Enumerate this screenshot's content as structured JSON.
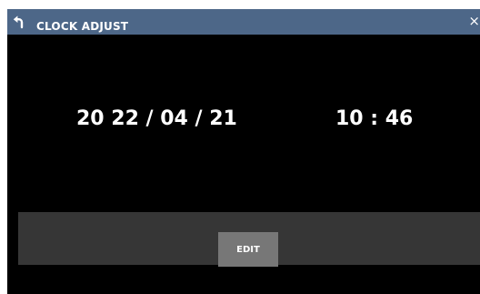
{
  "window": {
    "title": "CLOCK ADJUST",
    "back_icon": "back-arrow-icon",
    "close_icon": "close-icon",
    "close_glyph": "×",
    "titlebar_color": "#4d6788"
  },
  "clock": {
    "date": "20 22 / 04 / 21",
    "time": "10 : 46"
  },
  "actions": {
    "edit_label": "EDIT"
  }
}
